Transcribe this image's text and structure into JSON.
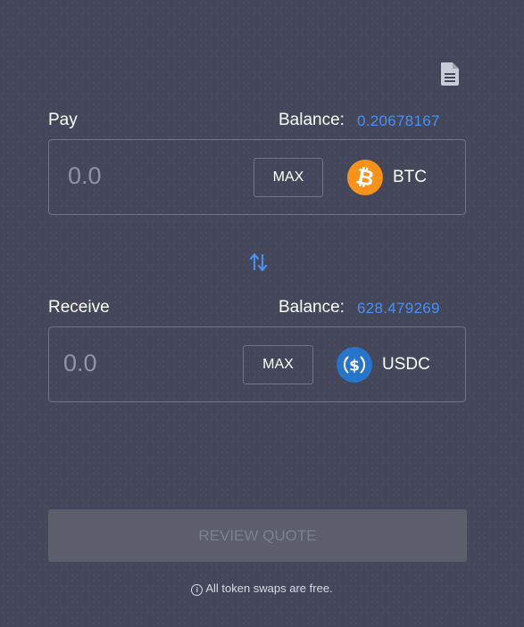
{
  "header": {
    "document_icon": "document-icon"
  },
  "pay": {
    "label": "Pay",
    "balance_label": "Balance:",
    "balance_value": "0.20678167",
    "amount_placeholder": "0.0",
    "max_label": "MAX",
    "token": {
      "symbol": "BTC",
      "icon": "bitcoin-icon",
      "color": "#f7931a"
    }
  },
  "swap_direction_icon": "swap-arrows-icon",
  "receive": {
    "label": "Receive",
    "balance_label": "Balance:",
    "balance_value": "628.479269",
    "amount_placeholder": "0.0",
    "max_label": "MAX",
    "token": {
      "symbol": "USDC",
      "icon": "usdc-icon",
      "color": "#2775ca"
    }
  },
  "review_button": {
    "label": "REVIEW QUOTE",
    "disabled": true
  },
  "footer": {
    "note": "All token swaps are free.",
    "icon": "info-icon"
  },
  "colors": {
    "background": "#434759",
    "accent": "#4a8ff2",
    "border": "#6f7384"
  }
}
